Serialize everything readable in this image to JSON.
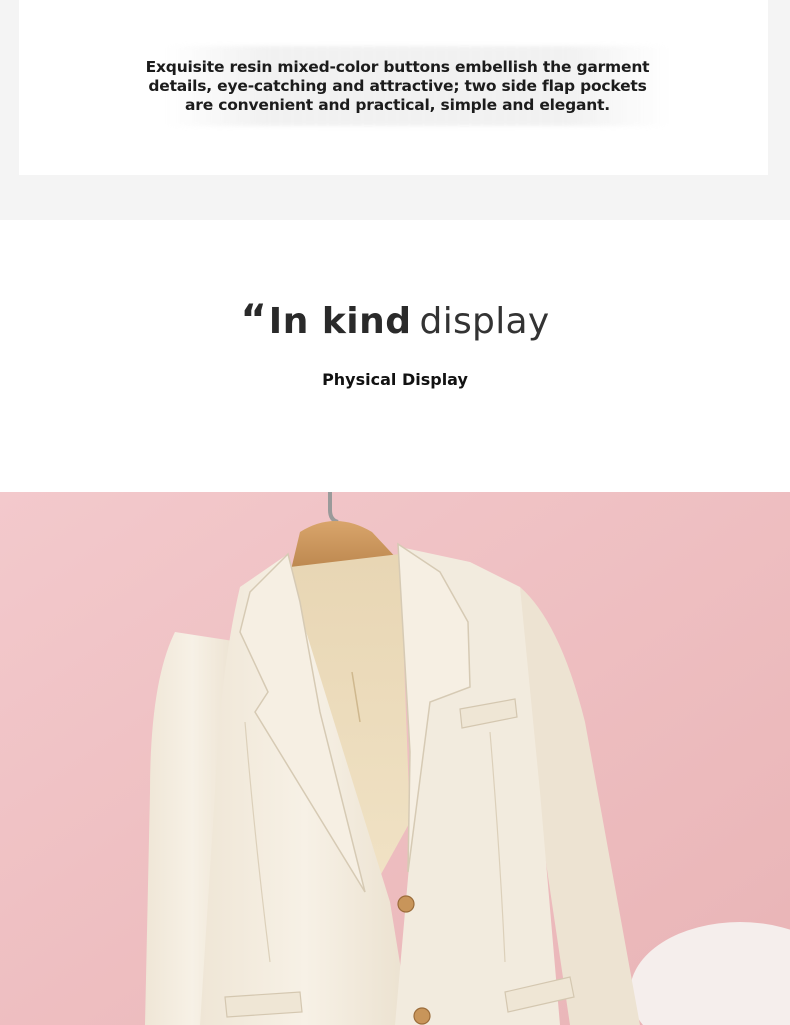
{
  "details_section": {
    "caption": "Exquisite resin mixed-color buttons embellish the garment details, eye-catching and attractive; two side flap pockets are convenient and practical, simple and elegant."
  },
  "display_section": {
    "quote_mark": "“",
    "title_bold": "In kind",
    "title_light": "display",
    "subtitle": "Physical Display"
  },
  "photo": {
    "subject": "cream-blazer-on-wooden-hanger",
    "background_color": "#efc1c3",
    "garment_color": "#f3ecdf"
  }
}
